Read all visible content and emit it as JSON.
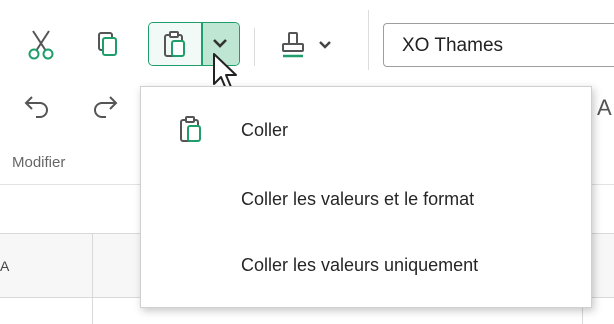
{
  "ribbon": {
    "buttons": {
      "cut": "scissors-icon",
      "copy": "copy-icon",
      "paste": "clipboard-icon",
      "paste_menu": "chevron-down-icon",
      "format_painter": "paint-brush-icon",
      "format_painter_menu": "chevron-down-icon",
      "undo": "undo-icon",
      "redo": "redo-icon"
    },
    "font_name": "XO Thames",
    "group_label": "Modifier",
    "accent_color": "#1f9e6b"
  },
  "sheet": {
    "partial_col_header": "A",
    "partial_cut_letter": "A"
  },
  "paste_menu": {
    "items": [
      {
        "label": "Coller",
        "icon": "clipboard-icon"
      },
      {
        "label": "Coller les valeurs et le format",
        "icon": ""
      },
      {
        "label": "Coller les valeurs uniquement",
        "icon": ""
      }
    ]
  }
}
